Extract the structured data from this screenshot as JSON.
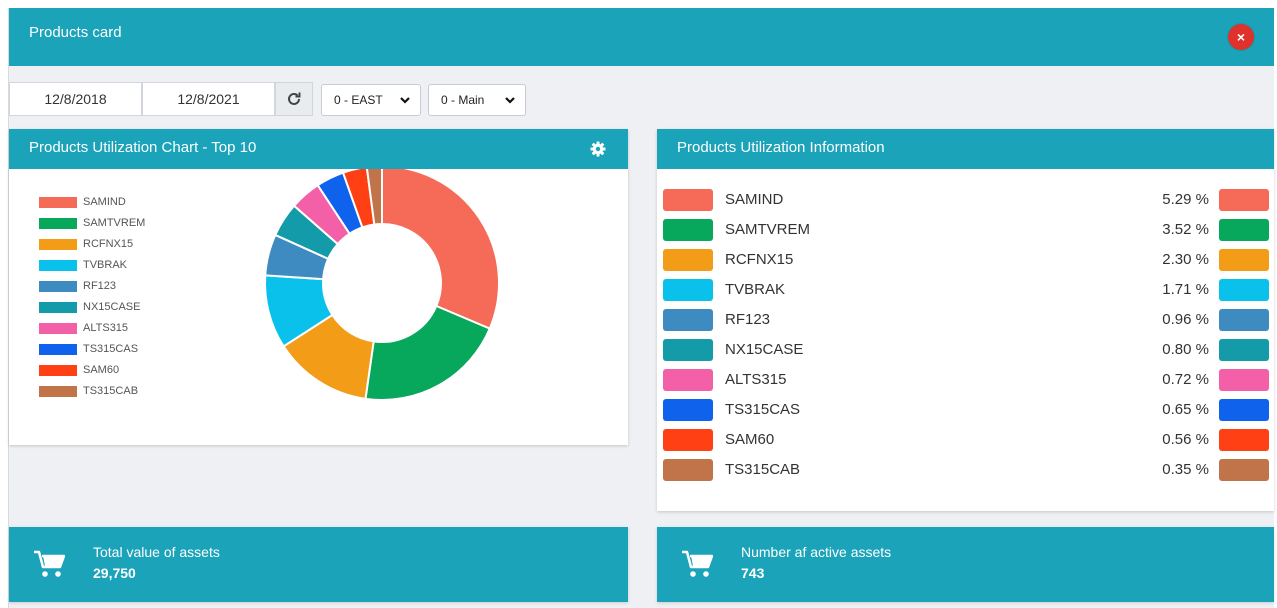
{
  "card": {
    "title": "Products card",
    "close_icon": "close-icon",
    "close_symbol": "×"
  },
  "filters": {
    "start_date": "12/8/2018",
    "end_date": "12/8/2021",
    "refresh_icon": "refresh-icon",
    "region": {
      "selected": "0 - EAST"
    },
    "store": {
      "selected": "0 - Main"
    }
  },
  "chart_panel": {
    "title": "Products Utilization Chart - Top 10",
    "settings_icon": "gear-icon"
  },
  "info_panel": {
    "title": "Products Utilization Information",
    "rows": [
      {
        "name": "SAMIND",
        "pct": "5.29 %"
      },
      {
        "name": "SAMTVREM",
        "pct": "3.52 %"
      },
      {
        "name": "RCFNX15",
        "pct": "2.30 %"
      },
      {
        "name": "TVBRAK",
        "pct": "1.71 %"
      },
      {
        "name": "RF123",
        "pct": "0.96 %"
      },
      {
        "name": "NX15CASE",
        "pct": "0.80 %"
      },
      {
        "name": "ALTS315",
        "pct": "0.72 %"
      },
      {
        "name": "TS315CAS",
        "pct": "0.65 %"
      },
      {
        "name": "SAM60",
        "pct": "0.56 %"
      },
      {
        "name": "TS315CAB",
        "pct": "0.35 %"
      }
    ]
  },
  "kpis": [
    {
      "title": "Total value of assets",
      "value": "29,750",
      "icon": "cart-icon"
    },
    {
      "title": "Number af active assets",
      "value": "743",
      "icon": "cart-icon"
    }
  ],
  "chart_data": {
    "type": "pie",
    "donut": true,
    "legend_position": "left",
    "categories": [
      "SAMIND",
      "SAMTVREM",
      "RCFNX15",
      "TVBRAK",
      "RF123",
      "NX15CASE",
      "ALTS315",
      "TS315CAS",
      "SAM60",
      "TS315CAB"
    ],
    "values": [
      5.29,
      3.52,
      2.3,
      1.71,
      0.96,
      0.8,
      0.72,
      0.65,
      0.56,
      0.35
    ],
    "colors": [
      "#f56b58",
      "#07a75c",
      "#f29c18",
      "#0ac1ec",
      "#3d8bc0",
      "#139ba9",
      "#f460a8",
      "#0e62eb",
      "#ff4014",
      "#c1734a"
    ]
  }
}
